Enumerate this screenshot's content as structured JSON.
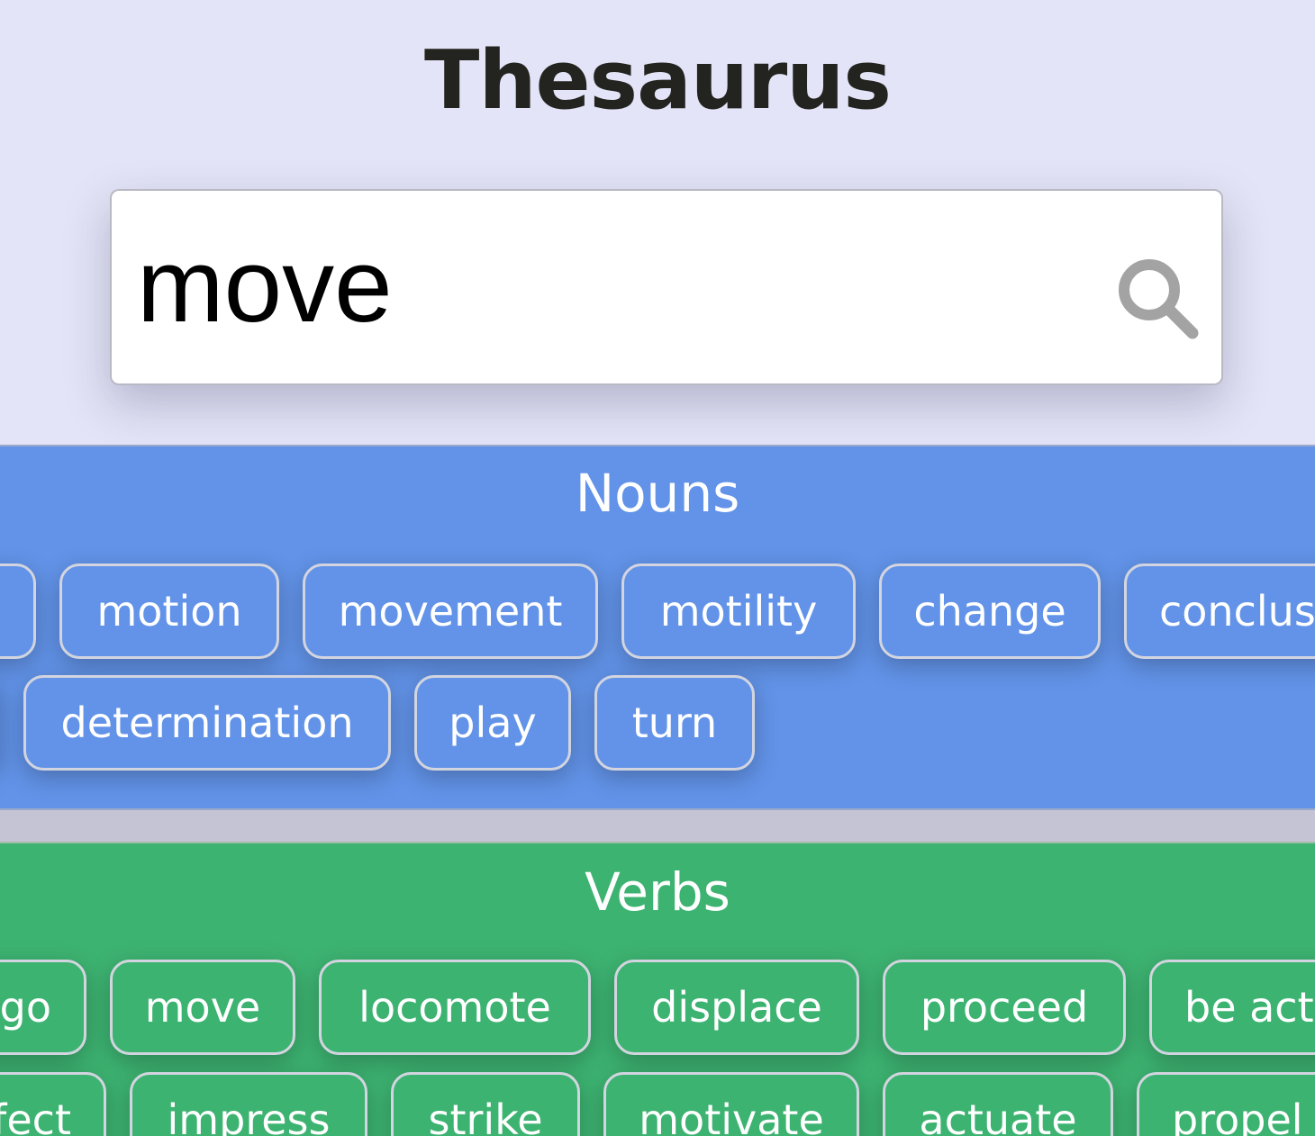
{
  "app": {
    "title": "Thesaurus"
  },
  "search": {
    "value": "move",
    "placeholder": ""
  },
  "nouns": {
    "heading": "Nouns",
    "row1": [
      "",
      "motion",
      "movement",
      "motility",
      "change",
      "conclus"
    ],
    "row2": [
      "",
      "determination",
      "play",
      "turn"
    ]
  },
  "verbs": {
    "heading": "Verbs",
    "row1": [
      "go",
      "move",
      "locomote",
      "displace",
      "proceed",
      "be act"
    ],
    "row2": [
      "fect",
      "impress",
      "strike",
      "motivate",
      "actuate",
      "propel"
    ]
  },
  "colors": {
    "background": "#e3e4f7",
    "nouns_band": "#6293e8",
    "verbs_band": "#3db371",
    "chip_border": "#d2d5df",
    "title_text": "#23241f"
  },
  "icons": {
    "search": "search-icon"
  }
}
